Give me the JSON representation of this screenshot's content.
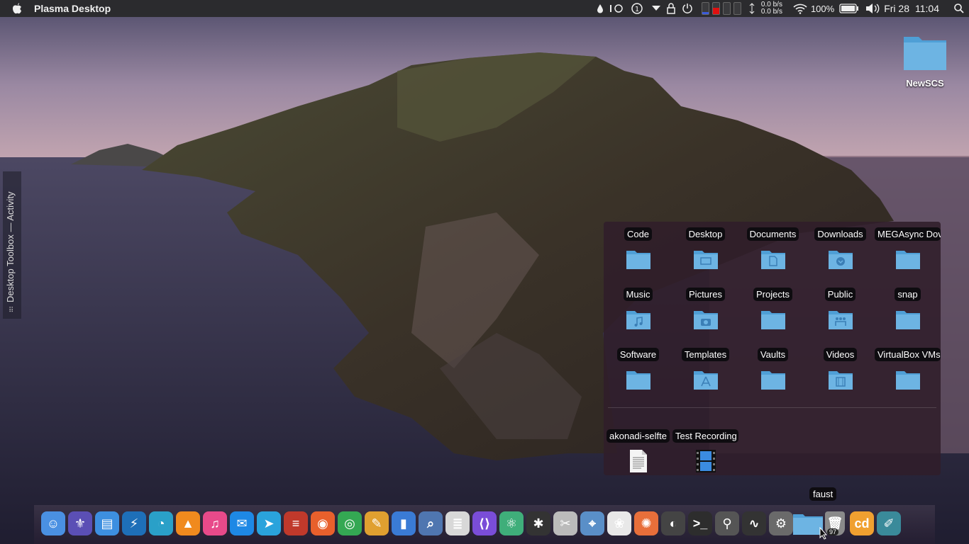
{
  "menubar": {
    "app_title": "Plasma Desktop",
    "net_up": "0.0 b/s",
    "net_down": "0.0 b/s",
    "battery_pct": "100%",
    "date": "Fri 28",
    "time": "11:04"
  },
  "side_toolbox": {
    "label": "Desktop Toolbox — Activity"
  },
  "desktop_icon": {
    "label": "NewSCS"
  },
  "folderview": {
    "folders": [
      {
        "label": "Code",
        "icon": "folder-icon"
      },
      {
        "label": "Desktop",
        "icon": "folder-desktop-icon"
      },
      {
        "label": "Documents",
        "icon": "folder-documents-icon"
      },
      {
        "label": "Downloads",
        "icon": "folder-downloads-icon"
      },
      {
        "label": "MEGAsync Dov",
        "icon": "folder-icon"
      },
      {
        "label": "Music",
        "icon": "folder-music-icon"
      },
      {
        "label": "Pictures",
        "icon": "folder-pictures-icon"
      },
      {
        "label": "Projects",
        "icon": "folder-icon"
      },
      {
        "label": "Public",
        "icon": "folder-public-icon"
      },
      {
        "label": "snap",
        "icon": "folder-icon"
      },
      {
        "label": "Software",
        "icon": "folder-icon"
      },
      {
        "label": "Templates",
        "icon": "folder-templates-icon"
      },
      {
        "label": "Vaults",
        "icon": "folder-icon"
      },
      {
        "label": "Videos",
        "icon": "folder-videos-icon"
      },
      {
        "label": "VirtualBox VMs",
        "icon": "folder-icon"
      }
    ],
    "files": [
      {
        "label": "akonadi-selfte",
        "icon": "text-file-icon"
      },
      {
        "label": "Test Recording",
        "icon": "video-file-icon"
      }
    ]
  },
  "tooltip": {
    "text": "faust"
  },
  "dock": {
    "trash_count": "97",
    "apps": [
      {
        "name": "finder-icon",
        "color": "#4a90e2",
        "glyph": "☺"
      },
      {
        "name": "kde-connect-icon",
        "color": "#5b4fb5",
        "glyph": "⚜"
      },
      {
        "name": "file-manager-icon",
        "color": "#3d8fe0",
        "glyph": "▤"
      },
      {
        "name": "usb-icon",
        "color": "#1e6fb8",
        "glyph": "⚡"
      },
      {
        "name": "discover-icon",
        "color": "#2aa0c8",
        "glyph": "◔"
      },
      {
        "name": "vlc-icon",
        "color": "#f08a1e",
        "glyph": "▲"
      },
      {
        "name": "itunes-icon",
        "color": "#e84a8a",
        "glyph": "♫"
      },
      {
        "name": "messenger-icon",
        "color": "#1e88e5",
        "glyph": "✉"
      },
      {
        "name": "telegram-icon",
        "color": "#2aa3dc",
        "glyph": "➤"
      },
      {
        "name": "news-icon",
        "color": "#c0392b",
        "glyph": "≡"
      },
      {
        "name": "firefox-icon",
        "color": "#e8602c",
        "glyph": "◉"
      },
      {
        "name": "chrome-icon",
        "color": "#34a853",
        "glyph": "◎"
      },
      {
        "name": "notes-icon",
        "color": "#e0a030",
        "glyph": "✎"
      },
      {
        "name": "charts-icon",
        "color": "#3a7bd5",
        "glyph": "▮"
      },
      {
        "name": "preview-icon",
        "color": "#4f76b0",
        "glyph": "⌕"
      },
      {
        "name": "text-editor-icon",
        "color": "#d8d8d8",
        "glyph": "≣"
      },
      {
        "name": "vscode-icon",
        "color": "#7a4dd8",
        "glyph": "⟨⟩"
      },
      {
        "name": "atom-icon",
        "color": "#3fae7a",
        "glyph": "⚛"
      },
      {
        "name": "video-editor-icon",
        "color": "#333333",
        "glyph": "✱"
      },
      {
        "name": "scripts-icon",
        "color": "#bbbbbb",
        "glyph": "✂"
      },
      {
        "name": "screenshot-icon",
        "color": "#5a8fc8",
        "glyph": "⌖"
      },
      {
        "name": "photos-editor-icon",
        "color": "#e8e8e8",
        "glyph": "❀"
      },
      {
        "name": "color-wheel-icon",
        "color": "#e86f3a",
        "glyph": "✺"
      },
      {
        "name": "photoscape-icon",
        "color": "#444444",
        "glyph": "◐"
      },
      {
        "name": "terminal-icon",
        "color": "#2d2d2d",
        "glyph": ">_"
      },
      {
        "name": "brush-icon",
        "color": "#555555",
        "glyph": "⚲"
      },
      {
        "name": "activity-monitor-icon",
        "color": "#333333",
        "glyph": "∿"
      },
      {
        "name": "system-settings-icon",
        "color": "#6a6a6a",
        "glyph": "⚙"
      },
      {
        "name": "faust-folder-icon",
        "color": "#4a9ed8",
        "glyph": ""
      },
      {
        "name": "trash-icon",
        "color": "#8a8a8a",
        "glyph": "🗑"
      },
      {
        "name": "cd-ripper-icon",
        "color": "#f0a030",
        "glyph": "cd"
      },
      {
        "name": "krita-icon",
        "color": "#3a8a9a",
        "glyph": "✐"
      }
    ]
  }
}
